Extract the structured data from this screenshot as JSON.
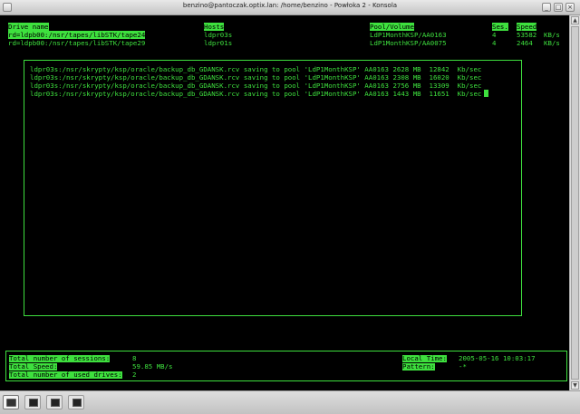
{
  "window": {
    "title": "benzino@pantoczak.optix.lan: /home/benzino - Powłoka 2 - Konsola"
  },
  "table": {
    "headers": {
      "drive": "Drive name",
      "host": "Hosts",
      "pool": "Pool/Volume",
      "ses": "Ses.",
      "speed": "Speed"
    },
    "rows": [
      {
        "drive": "rd=ldpb00:/nsr/tapes/libSTK/tape24",
        "host": "ldpr03s",
        "pool": "LdP1MonthKSP/AA0163",
        "ses": "4",
        "speed": "53582",
        "unit": "KB/s"
      },
      {
        "drive": "rd=ldpb00:/nsr/tapes/libSTK/tape29",
        "host": "ldpr01s",
        "pool": "LdP1MonthKSP/AA0075",
        "ses": "4",
        "speed": "2464",
        "unit": "KB/s"
      }
    ]
  },
  "log": [
    "ldpr03s:/nsr/skrypty/ksp/oracle/backup_db_GDANSK.rcv saving to pool 'LdP1MonthKSP' AA0163 2628 MB  12842  Kb/sec",
    "ldpr03s:/nsr/skrypty/ksp/oracle/backup_db_GDANSK.rcv saving to pool 'LdP1MonthKSP' AA0163 2308 MB  16020  Kb/sec",
    "ldpr03s:/nsr/skrypty/ksp/oracle/backup_db_GDANSK.rcv saving to pool 'LdP1MonthKSP' AA0163 2756 MB  13309  Kb/sec",
    "ldpr03s:/nsr/skrypty/ksp/oracle/backup_db_GDANSK.rcv saving to pool 'LdP1MonthKSP' AA0163 1443 MB  11651  Kb/sec"
  ],
  "status": {
    "sessions_label": "Total number of sessions:",
    "sessions_value": "8",
    "speed_label": "Total Speed:",
    "speed_value": "59.85 MB/s",
    "drives_label": "Total number of used drives:",
    "drives_value": "2",
    "time_label": "Local Time:",
    "time_value": "2005-05-16 10:03:17",
    "pattern_label": "Pattern:",
    "pattern_value": "-*"
  },
  "icons": {
    "minimize": "minimize-icon",
    "maximize": "maximize-icon",
    "close": "close-icon"
  },
  "colors": {
    "terminal_fg": "#3ee03e",
    "terminal_bg": "#000000"
  }
}
